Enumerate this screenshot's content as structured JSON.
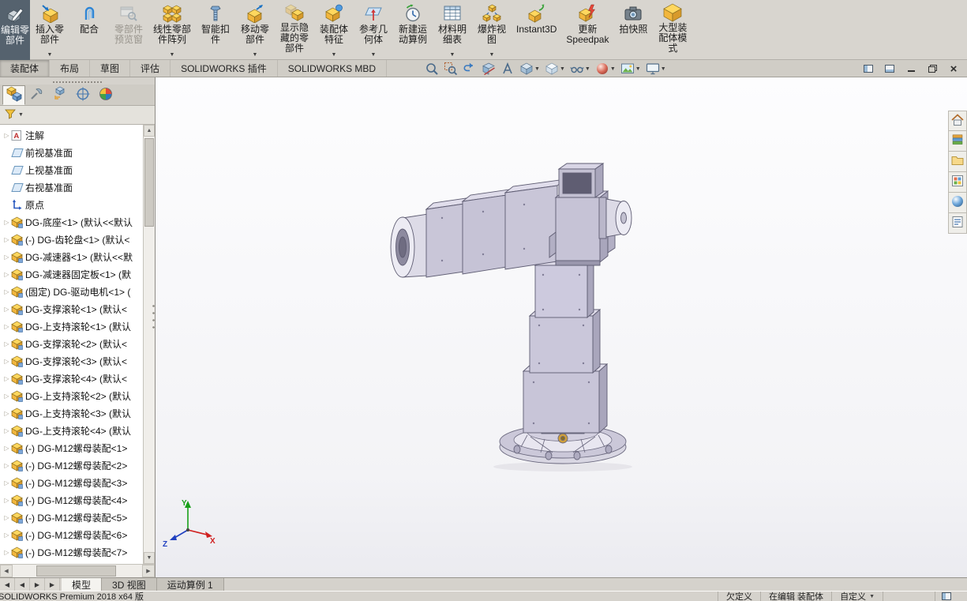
{
  "ribbon": {
    "edit_component": {
      "name": "edit-component",
      "lines": [
        "编辑零",
        "部件"
      ]
    },
    "buttons": [
      {
        "name": "insert-components",
        "lines": [
          "插入零",
          "部件"
        ],
        "dropdown": true,
        "disabled": false
      },
      {
        "name": "mate",
        "lines": [
          "配合"
        ],
        "dropdown": false,
        "disabled": false
      },
      {
        "name": "component-preview",
        "lines": [
          "零部件",
          "预览窗"
        ],
        "dropdown": false,
        "disabled": true
      },
      {
        "name": "linear-pattern",
        "lines": [
          "线性零部",
          "件阵列"
        ],
        "dropdown": true,
        "disabled": false
      },
      {
        "name": "smart-fasteners",
        "lines": [
          "智能扣",
          "件"
        ],
        "dropdown": false,
        "disabled": false
      },
      {
        "name": "move-component",
        "lines": [
          "移动零",
          "部件"
        ],
        "dropdown": true,
        "disabled": false
      },
      {
        "name": "show-hidden",
        "lines": [
          "显示隐",
          "藏的零",
          "部件"
        ],
        "dropdown": false,
        "disabled": false
      },
      {
        "name": "assembly-features",
        "lines": [
          "装配体",
          "特征"
        ],
        "dropdown": true,
        "disabled": false
      },
      {
        "name": "reference-geometry",
        "lines": [
          "参考几",
          "何体"
        ],
        "dropdown": true,
        "disabled": false
      },
      {
        "name": "motion-study",
        "lines": [
          "新建运",
          "动算例"
        ],
        "dropdown": false,
        "disabled": false
      },
      {
        "name": "bill-of-materials",
        "lines": [
          "材料明",
          "细表"
        ],
        "dropdown": true,
        "disabled": false
      },
      {
        "name": "exploded-view",
        "lines": [
          "爆炸视",
          "图"
        ],
        "dropdown": true,
        "disabled": false
      },
      {
        "name": "instant3d",
        "lines": [
          "Instant3D"
        ],
        "dropdown": false,
        "disabled": false
      },
      {
        "name": "update-speedpak",
        "lines": [
          "更新",
          "Speedpak"
        ],
        "dropdown": false,
        "disabled": false
      },
      {
        "name": "take-snapshot",
        "lines": [
          "拍快照"
        ],
        "dropdown": false,
        "disabled": false
      },
      {
        "name": "large-assembly",
        "lines": [
          "大型装",
          "配体模",
          "式"
        ],
        "dropdown": false,
        "disabled": false
      }
    ]
  },
  "command_tabs": {
    "items": [
      {
        "label": "装配体",
        "active": true
      },
      {
        "label": "布局",
        "active": false
      },
      {
        "label": "草图",
        "active": false
      },
      {
        "label": "评估",
        "active": false
      },
      {
        "label": "SOLIDWORKS 插件",
        "active": false
      },
      {
        "label": "SOLIDWORKS MBD",
        "active": false
      }
    ]
  },
  "heads_up": {
    "items": [
      {
        "name": "zoom-to-fit",
        "dropdown": false
      },
      {
        "name": "zoom-to-area",
        "dropdown": false
      },
      {
        "name": "previous-view",
        "dropdown": false
      },
      {
        "name": "section-view",
        "dropdown": false
      },
      {
        "name": "dynamic-annotation-views",
        "dropdown": false
      },
      {
        "name": "view-orientation",
        "dropdown": true
      },
      {
        "name": "display-style",
        "dropdown": true
      },
      {
        "name": "hide-show-items",
        "dropdown": true
      },
      {
        "name": "edit-appearance",
        "dropdown": true
      },
      {
        "name": "apply-scene",
        "dropdown": true
      },
      {
        "name": "view-settings",
        "dropdown": true
      }
    ]
  },
  "window_controls": {
    "items": [
      "pane-toggle",
      "pane-toggle-2",
      "minimize",
      "restore-down",
      "close"
    ]
  },
  "feature_panel": {
    "filter": {
      "icon": "filter-funnel"
    },
    "tabs": [
      {
        "name": "feature-manager",
        "active": true
      },
      {
        "name": "property-manager",
        "active": false
      },
      {
        "name": "configuration-manager",
        "active": false
      },
      {
        "name": "dimxpert-manager",
        "active": false
      },
      {
        "name": "display-manager",
        "active": false
      }
    ],
    "tree_items": [
      {
        "label": "注解",
        "icon": "annotations-folder",
        "expand": true
      },
      {
        "label": "前视基准面",
        "icon": "reference-plane",
        "expand": false
      },
      {
        "label": "上视基准面",
        "icon": "reference-plane",
        "expand": false
      },
      {
        "label": "右视基准面",
        "icon": "reference-plane",
        "expand": false
      },
      {
        "label": "原点",
        "icon": "origin",
        "expand": false
      },
      {
        "label": "DG-底座<1> (默认<<默认",
        "icon": "component",
        "expand": true
      },
      {
        "label": "(-) DG-齿轮盘<1> (默认<",
        "icon": "component",
        "expand": true
      },
      {
        "label": "DG-减速器<1> (默认<<默",
        "icon": "component",
        "expand": true
      },
      {
        "label": "DG-减速器固定板<1> (默",
        "icon": "component",
        "expand": true
      },
      {
        "label": "(固定) DG-驱动电机<1> (",
        "icon": "component",
        "expand": true
      },
      {
        "label": "DG-支撑滚轮<1> (默认<",
        "icon": "component",
        "expand": true
      },
      {
        "label": "DG-上支持滚轮<1> (默认",
        "icon": "component",
        "expand": true
      },
      {
        "label": "DG-支撑滚轮<2> (默认<",
        "icon": "component",
        "expand": true
      },
      {
        "label": "DG-支撑滚轮<3> (默认<",
        "icon": "component",
        "expand": true
      },
      {
        "label": "DG-支撑滚轮<4> (默认<",
        "icon": "component",
        "expand": true
      },
      {
        "label": "DG-上支持滚轮<2> (默认",
        "icon": "component",
        "expand": true
      },
      {
        "label": "DG-上支持滚轮<3> (默认",
        "icon": "component",
        "expand": true
      },
      {
        "label": "DG-上支持滚轮<4> (默认",
        "icon": "component",
        "expand": true
      },
      {
        "label": "(-) DG-M12螺母装配<1>",
        "icon": "component",
        "expand": true
      },
      {
        "label": "(-) DG-M12螺母装配<2>",
        "icon": "component",
        "expand": true
      },
      {
        "label": "(-) DG-M12螺母装配<3>",
        "icon": "component",
        "expand": true
      },
      {
        "label": "(-) DG-M12螺母装配<4>",
        "icon": "component",
        "expand": true
      },
      {
        "label": "(-) DG-M12螺母装配<5>",
        "icon": "component",
        "expand": true
      },
      {
        "label": "(-) DG-M12螺母装配<6>",
        "icon": "component",
        "expand": true
      },
      {
        "label": "(-) DG-M12螺母装配<7>",
        "icon": "component",
        "expand": true
      }
    ]
  },
  "task_pane": {
    "items": [
      {
        "name": "solidworks-resources"
      },
      {
        "name": "design-library"
      },
      {
        "name": "file-explorer"
      },
      {
        "name": "view-palette"
      },
      {
        "name": "appearances-scenes"
      },
      {
        "name": "custom-properties"
      }
    ]
  },
  "viewport": {
    "triad": {
      "x": "X",
      "y": "Y",
      "z": "Z"
    }
  },
  "bottom_bar": {
    "tabs": [
      {
        "label": "模型",
        "active": true
      },
      {
        "label": "3D 视图",
        "active": false
      },
      {
        "label": "运动算例 1",
        "active": false
      }
    ]
  },
  "status_bar": {
    "app_version": "SOLIDWORKS Premium 2018 x64 版",
    "define_state": "欠定义",
    "editing_state": "在编辑 装配体",
    "custom_label": "自定义"
  }
}
